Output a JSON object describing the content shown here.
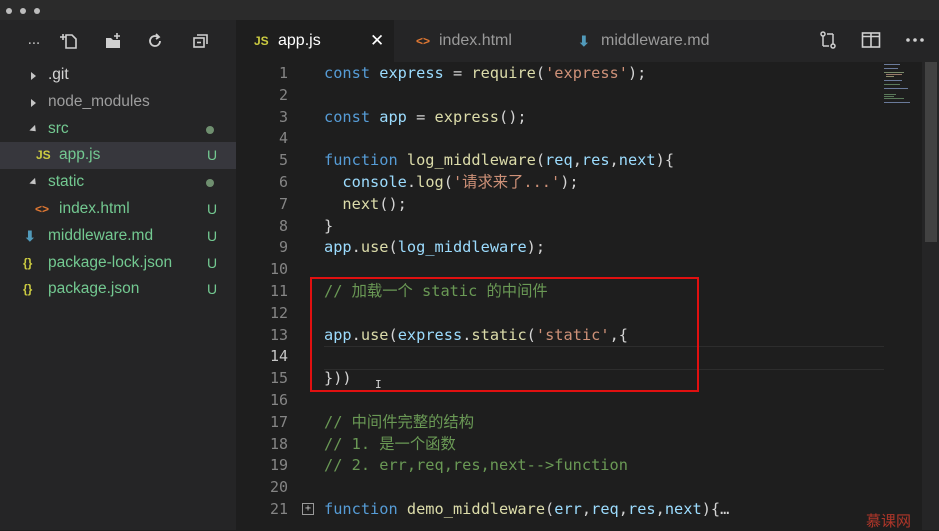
{
  "window": {
    "title": ""
  },
  "explorer": {
    "toolbar": {
      "more": "...",
      "icons": [
        "new-file-icon",
        "new-folder-icon",
        "refresh-icon",
        "collapse-icon"
      ]
    },
    "items": [
      {
        "label": ".git",
        "type": "folder",
        "expanded": false,
        "status": ""
      },
      {
        "label": "node_modules",
        "type": "folder",
        "expanded": false,
        "status": ""
      },
      {
        "label": "src",
        "type": "folder",
        "expanded": true,
        "status": "dot"
      },
      {
        "label": "app.js",
        "type": "js",
        "icon": "JS",
        "status": "U",
        "selected": true
      },
      {
        "label": "static",
        "type": "folder",
        "expanded": true,
        "status": "dot"
      },
      {
        "label": "index.html",
        "type": "html",
        "icon": "<>",
        "status": "U"
      },
      {
        "label": "middleware.md",
        "type": "md",
        "icon": "⬇",
        "status": "U"
      },
      {
        "label": "package-lock.json",
        "type": "json",
        "icon": "{}",
        "status": "U"
      },
      {
        "label": "package.json",
        "type": "json",
        "icon": "{}",
        "status": "U"
      }
    ]
  },
  "tabs": [
    {
      "icon": "JS",
      "label": "app.js",
      "active": true,
      "close": "✕"
    },
    {
      "icon": "<>",
      "label": "index.html",
      "active": false
    },
    {
      "icon": "⬇",
      "label": "middleware.md",
      "active": false
    }
  ],
  "editor": {
    "lines": [
      {
        "n": "1",
        "tokens": [
          [
            "kw",
            "const "
          ],
          [
            "var",
            "express"
          ],
          [
            "pu",
            " = "
          ],
          [
            "fn",
            "require"
          ],
          [
            "pu",
            "("
          ],
          [
            "str",
            "'express'"
          ],
          [
            "pu",
            ");"
          ]
        ]
      },
      {
        "n": "2",
        "tokens": []
      },
      {
        "n": "3",
        "tokens": [
          [
            "kw",
            "const "
          ],
          [
            "var",
            "app"
          ],
          [
            "pu",
            " = "
          ],
          [
            "fn",
            "express"
          ],
          [
            "pu",
            "();"
          ]
        ]
      },
      {
        "n": "4",
        "tokens": []
      },
      {
        "n": "5",
        "tokens": [
          [
            "kw",
            "function "
          ],
          [
            "fn",
            "log_middleware"
          ],
          [
            "pu",
            "("
          ],
          [
            "var",
            "req"
          ],
          [
            "pu",
            ","
          ],
          [
            "var",
            "res"
          ],
          [
            "pu",
            ","
          ],
          [
            "var",
            "next"
          ],
          [
            "pu",
            "){"
          ]
        ]
      },
      {
        "n": "6",
        "tokens": [
          [
            "pu",
            "  "
          ],
          [
            "var",
            "console"
          ],
          [
            "pu",
            "."
          ],
          [
            "fn",
            "log"
          ],
          [
            "pu",
            "("
          ],
          [
            "str",
            "'请求来了...'"
          ],
          [
            "pu",
            ");"
          ]
        ]
      },
      {
        "n": "7",
        "tokens": [
          [
            "pu",
            "  "
          ],
          [
            "fn",
            "next"
          ],
          [
            "pu",
            "();"
          ]
        ]
      },
      {
        "n": "8",
        "tokens": [
          [
            "pu",
            "}"
          ]
        ]
      },
      {
        "n": "9",
        "tokens": [
          [
            "var",
            "app"
          ],
          [
            "pu",
            "."
          ],
          [
            "fn",
            "use"
          ],
          [
            "pu",
            "("
          ],
          [
            "var",
            "log_middleware"
          ],
          [
            "pu",
            ");"
          ]
        ]
      },
      {
        "n": "10",
        "tokens": []
      },
      {
        "n": "11",
        "tokens": [
          [
            "cm",
            "// 加载一个 static 的中间件"
          ]
        ]
      },
      {
        "n": "12",
        "tokens": []
      },
      {
        "n": "13",
        "tokens": [
          [
            "var",
            "app"
          ],
          [
            "pu",
            "."
          ],
          [
            "fn",
            "use"
          ],
          [
            "pu",
            "("
          ],
          [
            "var",
            "express"
          ],
          [
            "pu",
            "."
          ],
          [
            "fn",
            "static"
          ],
          [
            "pu",
            "("
          ],
          [
            "str",
            "'static'"
          ],
          [
            "pu",
            ",{"
          ]
        ]
      },
      {
        "n": "14",
        "tokens": []
      },
      {
        "n": "15",
        "tokens": [
          [
            "pu",
            "}))"
          ]
        ]
      },
      {
        "n": "16",
        "tokens": []
      },
      {
        "n": "17",
        "tokens": [
          [
            "cm",
            "// 中间件完整的结构"
          ]
        ]
      },
      {
        "n": "18",
        "tokens": [
          [
            "cm",
            "// 1. 是一个函数"
          ]
        ]
      },
      {
        "n": "19",
        "tokens": [
          [
            "cm",
            "// 2. err,req,res,next-->function"
          ]
        ]
      },
      {
        "n": "20",
        "tokens": []
      },
      {
        "n": "21",
        "tokens": [
          [
            "kw",
            "function "
          ],
          [
            "fn",
            "demo_middleware"
          ],
          [
            "pu",
            "("
          ],
          [
            "var",
            "err"
          ],
          [
            "pu",
            ","
          ],
          [
            "var",
            "req"
          ],
          [
            "pu",
            ","
          ],
          [
            "var",
            "res"
          ],
          [
            "pu",
            ","
          ],
          [
            "var",
            "next"
          ],
          [
            "pu",
            "){"
          ],
          [
            "pu",
            "…"
          ]
        ]
      }
    ],
    "fold_marker": "+",
    "cursor_glyph": "I"
  },
  "watermark": "慕课网",
  "colors": {
    "highlight_box": "#e01010",
    "keyword": "#569cd6",
    "string": "#ce9178",
    "function": "#dcdcaa",
    "variable": "#9cdcfe",
    "comment": "#6a9955"
  }
}
